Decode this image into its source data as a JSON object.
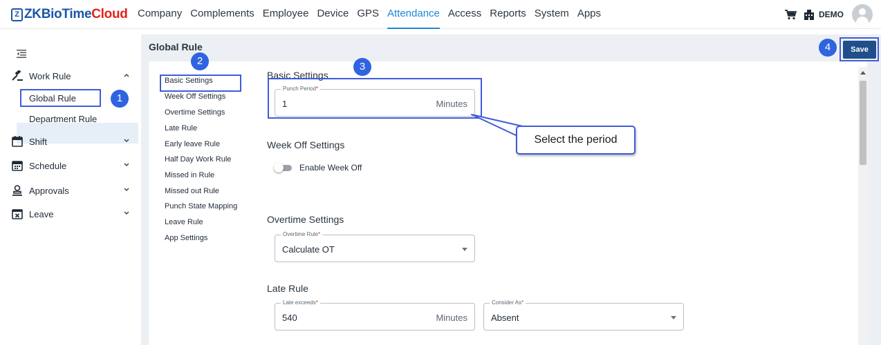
{
  "app": {
    "logo_mark": "Z",
    "logo_primary": "ZKBioTime",
    "logo_secondary": "Cloud",
    "brand_colors": {
      "primary": "#1a56a8",
      "accent": "#e2231a",
      "active_tab": "#1f86d6",
      "save": "#1e4f8b",
      "highlight": "#3f5bd9"
    }
  },
  "nav": {
    "items": [
      "Company",
      "Complements",
      "Employee",
      "Device",
      "GPS",
      "Attendance",
      "Access",
      "Reports",
      "System",
      "Apps"
    ],
    "active": "Attendance"
  },
  "top_right": {
    "cart_icon": "cart-icon",
    "building_icon": "building-icon",
    "company_label": "DEMO",
    "avatar_icon": "user-avatar-icon"
  },
  "sidebar": {
    "collapse_icon": "menu-collapse-icon",
    "groups": [
      {
        "label": "Work Rule",
        "icon": "gavel-icon",
        "expanded": true,
        "children": [
          "Global Rule",
          "Department Rule"
        ]
      },
      {
        "label": "Shift",
        "icon": "calendar-icon",
        "expanded": false
      },
      {
        "label": "Schedule",
        "icon": "calendar-grid-icon",
        "expanded": false
      },
      {
        "label": "Approvals",
        "icon": "approval-person-icon",
        "expanded": false
      },
      {
        "label": "Leave",
        "icon": "calendar-x-icon",
        "expanded": false
      }
    ],
    "active_item": "Global Rule"
  },
  "page": {
    "title": "Global Rule",
    "save_label": "Save"
  },
  "subnav": {
    "items": [
      "Basic Settings",
      "Week Off Settings",
      "Overtime Settings",
      "Late Rule",
      "Early leave Rule",
      "Half Day Work Rule",
      "Missed in Rule",
      "Missed out Rule",
      "Punch State Mapping",
      "Leave Rule",
      "App Settings"
    ],
    "active": "Basic Settings"
  },
  "basic_settings": {
    "title": "Basic Settings",
    "punch_period": {
      "label": "Punch Period",
      "required_mark": "*",
      "value": "1",
      "suffix": "Minutes"
    }
  },
  "week_off": {
    "title": "Week Off Settings",
    "toggle_label": "Enable Week Off",
    "enabled": false
  },
  "overtime": {
    "title": "Overtime Settings",
    "rule": {
      "label": "Overtime Rule",
      "required_mark": "*",
      "value": "Calculate OT"
    }
  },
  "late_rule": {
    "title": "Late Rule",
    "exceeds": {
      "label": "Late exceeds",
      "required_mark": "*",
      "value": "540",
      "suffix": "Minutes"
    },
    "consider_as": {
      "label": "Consider As",
      "required_mark": "*",
      "value": "Absent"
    }
  },
  "overlay": {
    "steps": [
      "1",
      "2",
      "3",
      "4"
    ],
    "callout_text": "Select the period"
  }
}
